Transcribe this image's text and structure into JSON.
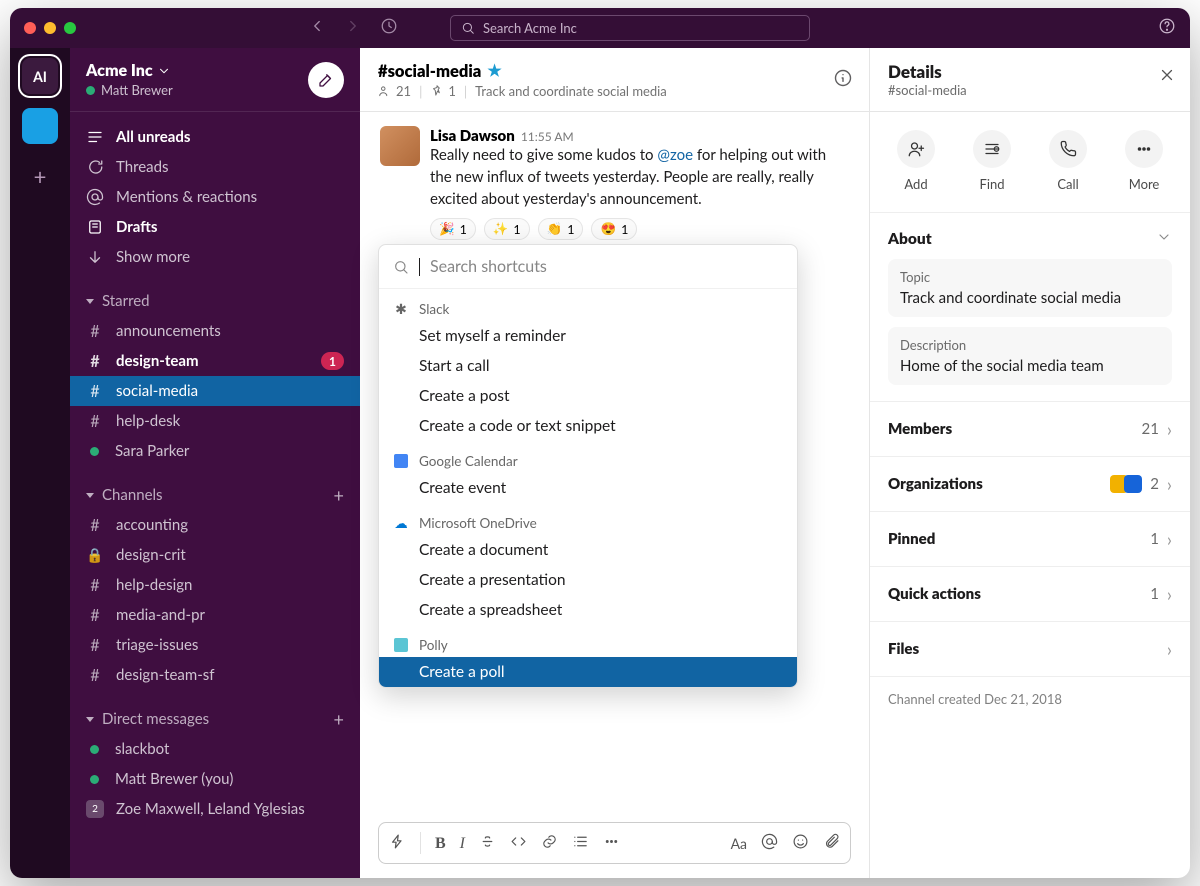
{
  "workspace": {
    "initials": "AI",
    "name": "Acme Inc",
    "user": "Matt Brewer",
    "search_placeholder": "Search Acme Inc"
  },
  "sidebar": {
    "nav": [
      {
        "label": "All unreads",
        "bold": true,
        "icon": "list"
      },
      {
        "label": "Threads",
        "icon": "threads"
      },
      {
        "label": "Mentions & reactions",
        "icon": "at"
      },
      {
        "label": "Drafts",
        "bold": true,
        "icon": "drafts"
      },
      {
        "label": "Show more",
        "icon": "chevdown"
      }
    ],
    "starred_label": "Starred",
    "starred": [
      {
        "prefix": "#",
        "label": "announcements"
      },
      {
        "prefix": "#",
        "label": "design-team",
        "bold": true,
        "badge": "1"
      },
      {
        "prefix": "#",
        "label": "social-media",
        "selected": true
      },
      {
        "prefix": "#",
        "label": "help-desk"
      },
      {
        "prefix": "●",
        "label": "Sara Parker",
        "presence": true
      }
    ],
    "channels_label": "Channels",
    "channels": [
      {
        "prefix": "#",
        "label": "accounting"
      },
      {
        "prefix": "lock",
        "label": "design-crit"
      },
      {
        "prefix": "#",
        "label": "help-design"
      },
      {
        "prefix": "#",
        "label": "media-and-pr"
      },
      {
        "prefix": "#",
        "label": "triage-issues"
      },
      {
        "prefix": "#",
        "label": "design-team-sf"
      }
    ],
    "dms_label": "Direct messages",
    "dms": [
      {
        "label": "slackbot",
        "presence": true
      },
      {
        "label": "Matt Brewer (you)",
        "presence": true
      },
      {
        "label": "Zoe Maxwell, Leland Yglesias",
        "multi": "2"
      }
    ]
  },
  "channel": {
    "name": "#social-media",
    "members": "21",
    "pinned": "1",
    "topic": "Track and coordinate social media"
  },
  "message": {
    "author": "Lisa Dawson",
    "time": "11:55 AM",
    "text_pre": "Really need to give some kudos to ",
    "mention": "@zoe",
    "text_post": " for helping out with the new influx of tweets yesterday. People are really, really excited about yesterday's announcement.",
    "reactions": [
      {
        "emoji": "🎉",
        "count": "1"
      },
      {
        "emoji": "✨",
        "count": "1"
      },
      {
        "emoji": "👏",
        "count": "1"
      },
      {
        "emoji": "😍",
        "count": "1"
      }
    ]
  },
  "shortcuts": {
    "search_placeholder": "Search shortcuts",
    "groups": [
      {
        "app": "Slack",
        "icon": "slack",
        "items": [
          "Set myself a reminder",
          "Start a call",
          "Create a post",
          "Create a code or text snippet"
        ]
      },
      {
        "app": "Google Calendar",
        "icon": "gcal",
        "items": [
          "Create event"
        ]
      },
      {
        "app": "Microsoft OneDrive",
        "icon": "onedrive",
        "items": [
          "Create a document",
          "Create a presentation",
          "Create a spreadsheet"
        ]
      },
      {
        "app": "Polly",
        "icon": "polly",
        "items": [
          "Create a poll"
        ],
        "selected_index": 0
      }
    ]
  },
  "details": {
    "title": "Details",
    "channel": "#social-media",
    "actions": [
      {
        "label": "Add",
        "icon": "adduser"
      },
      {
        "label": "Find",
        "icon": "find"
      },
      {
        "label": "Call",
        "icon": "call"
      },
      {
        "label": "More",
        "icon": "more"
      }
    ],
    "about_label": "About",
    "topic_label": "Topic",
    "topic": "Track and coordinate social media",
    "desc_label": "Description",
    "desc": "Home of the social media team",
    "rows": [
      {
        "label": "Members",
        "value": "21"
      },
      {
        "label": "Organizations",
        "value": "2",
        "orgs": true
      },
      {
        "label": "Pinned",
        "value": "1"
      },
      {
        "label": "Quick actions",
        "value": "1"
      },
      {
        "label": "Files",
        "value": ""
      }
    ],
    "created": "Channel created Dec 21, 2018"
  }
}
